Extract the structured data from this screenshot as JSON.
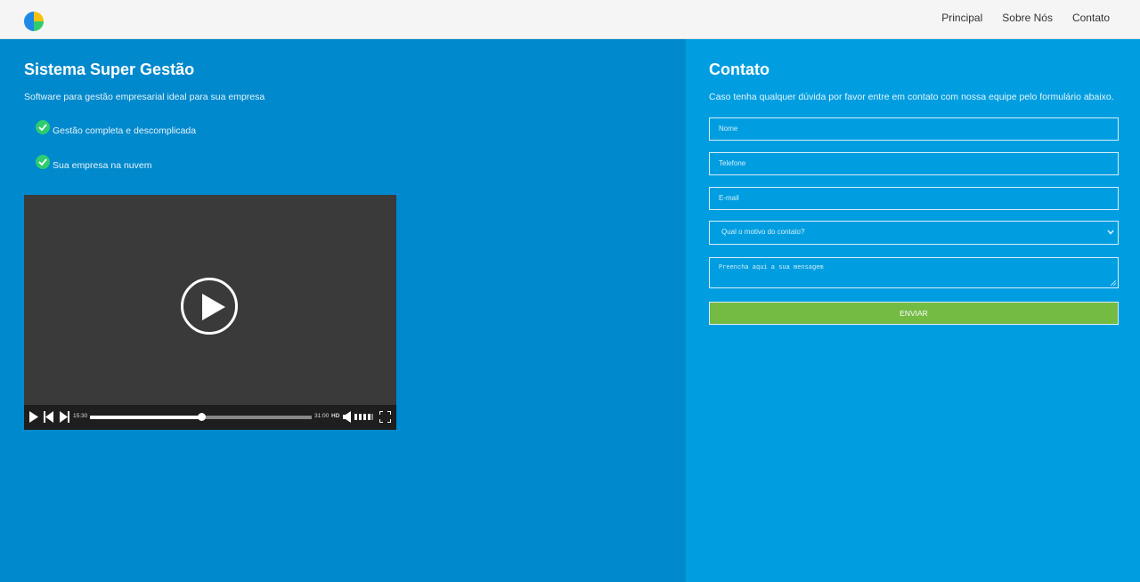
{
  "colors": {
    "topbar": "#f5f5f5",
    "left_panel": "#0089cc",
    "right_panel": "#009ee0",
    "check": "#2ecc71",
    "send_button": "#74bb43",
    "video_bg": "#3a3a3a"
  },
  "header": {
    "logo": "pie-chart-logo-icon",
    "nav": [
      "Principal",
      "Sobre Nós",
      "Contato"
    ]
  },
  "hero": {
    "title": "Sistema Super Gestão",
    "subtitle": "Software para gestão empresarial ideal para sua empresa",
    "features": [
      "Gestão completa e descomplicada",
      "Sua empresa na nuvem"
    ]
  },
  "video": {
    "current_time": "15:30",
    "total_time": "31:00",
    "quality": "HD",
    "progress": 0.5
  },
  "contact": {
    "title": "Contato",
    "subtitle": "Caso tenha qualquer dúvida por favor entre em contato com nossa equipe pelo formulário abaixo.",
    "fields": {
      "name_placeholder": "Nome",
      "phone_placeholder": "Telefone",
      "email_placeholder": "E-mail",
      "contact_method_selected": "Qual o motivo do contato?",
      "message_placeholder": "Preencha aqui a sua mensagem"
    },
    "submit_label": "ENVIAR"
  }
}
